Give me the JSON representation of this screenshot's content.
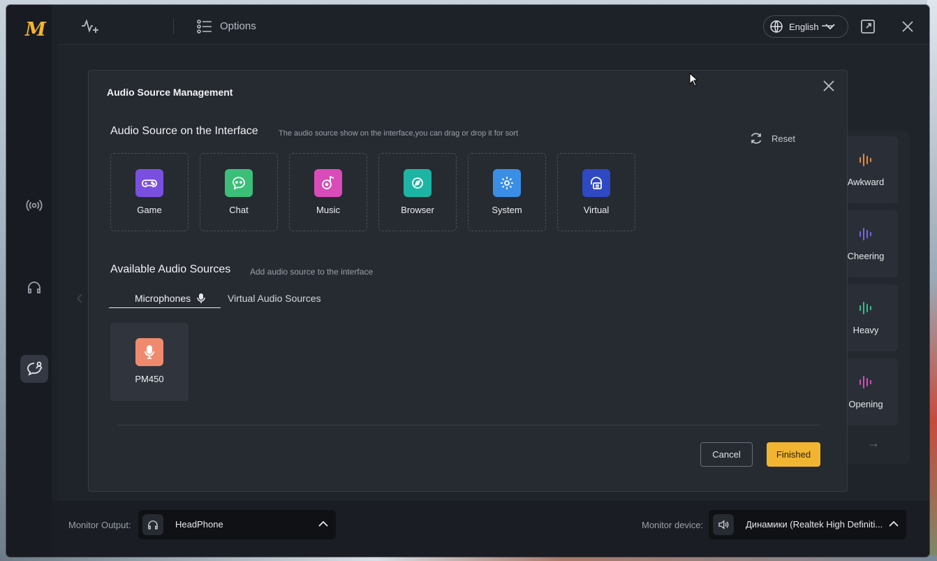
{
  "app": {
    "logo_text": "M",
    "options_label": "Options",
    "language": "English"
  },
  "effects_panel": {
    "items": [
      {
        "label": "Awkward",
        "color": "#e9893a"
      },
      {
        "label": "Cheering",
        "color": "#7b63e8"
      },
      {
        "label": "Heavy",
        "color": "#2fc08a"
      },
      {
        "label": "Opening",
        "color": "#d94bb8"
      }
    ]
  },
  "modal": {
    "title": "Audio Source Management",
    "interface_section": {
      "title": "Audio Source on the Interface",
      "subtitle": "The audio source show on the interface,you can drag or drop it for sort",
      "reset_label": "Reset",
      "sources": [
        {
          "label": "Game",
          "icon": "gamepad-icon",
          "color": "#7a4fe0"
        },
        {
          "label": "Chat",
          "icon": "chat-icon",
          "color": "#3bbf78"
        },
        {
          "label": "Music",
          "icon": "music-icon",
          "color": "#d94bb8"
        },
        {
          "label": "Browser",
          "icon": "browser-icon",
          "color": "#1cb5a3"
        },
        {
          "label": "System",
          "icon": "gear-icon",
          "color": "#3a8ee6"
        },
        {
          "label": "Virtual",
          "icon": "virtual-icon",
          "color": "#2f48c4"
        }
      ]
    },
    "available_section": {
      "title": "Available Audio Sources",
      "subtitle": "Add audio source to the interface",
      "tabs": [
        {
          "label": "Microphones",
          "active": true
        },
        {
          "label": "Virtual Audio Sources",
          "active": false
        }
      ],
      "items": [
        {
          "label": "PM450",
          "icon": "microphone-icon",
          "color": "#f08a6e"
        }
      ]
    },
    "cancel_label": "Cancel",
    "finish_label": "Finished"
  },
  "bottom_bar": {
    "monitor_output_label": "Monitor Output:",
    "monitor_output_value": "HeadPhone",
    "monitor_device_label": "Monitor device:",
    "monitor_device_value": "Динамики (Realtek High Definiti..."
  }
}
